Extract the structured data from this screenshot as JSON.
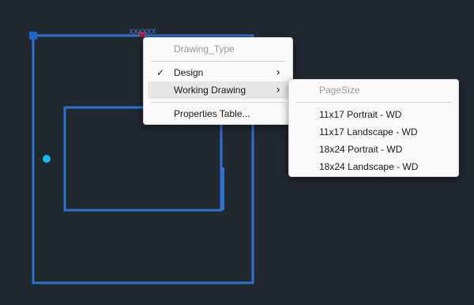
{
  "colors": {
    "background": "#212830",
    "outline": "#2f6fd0",
    "grip": "#1e63c8",
    "point": "#19b8e6",
    "marker": "#c0142a"
  },
  "canvas": {
    "grip_text": "XXXXXX"
  },
  "context_menu": {
    "header": "Drawing_Type",
    "items": [
      {
        "label": "Design",
        "checked": true,
        "submenu": true
      },
      {
        "label": "Working Drawing",
        "checked": false,
        "submenu": true
      },
      {
        "label": "Properties Table...",
        "checked": false,
        "submenu": false
      }
    ],
    "check_glyph": "✓",
    "arrow_glyph": "›"
  },
  "submenu": {
    "header": "PageSize",
    "items": [
      {
        "label": "11x17 Portrait - WD"
      },
      {
        "label": "11x17 Landscape - WD"
      },
      {
        "label": "18x24 Portrait - WD"
      },
      {
        "label": "18x24 Landscape - WD"
      }
    ]
  }
}
